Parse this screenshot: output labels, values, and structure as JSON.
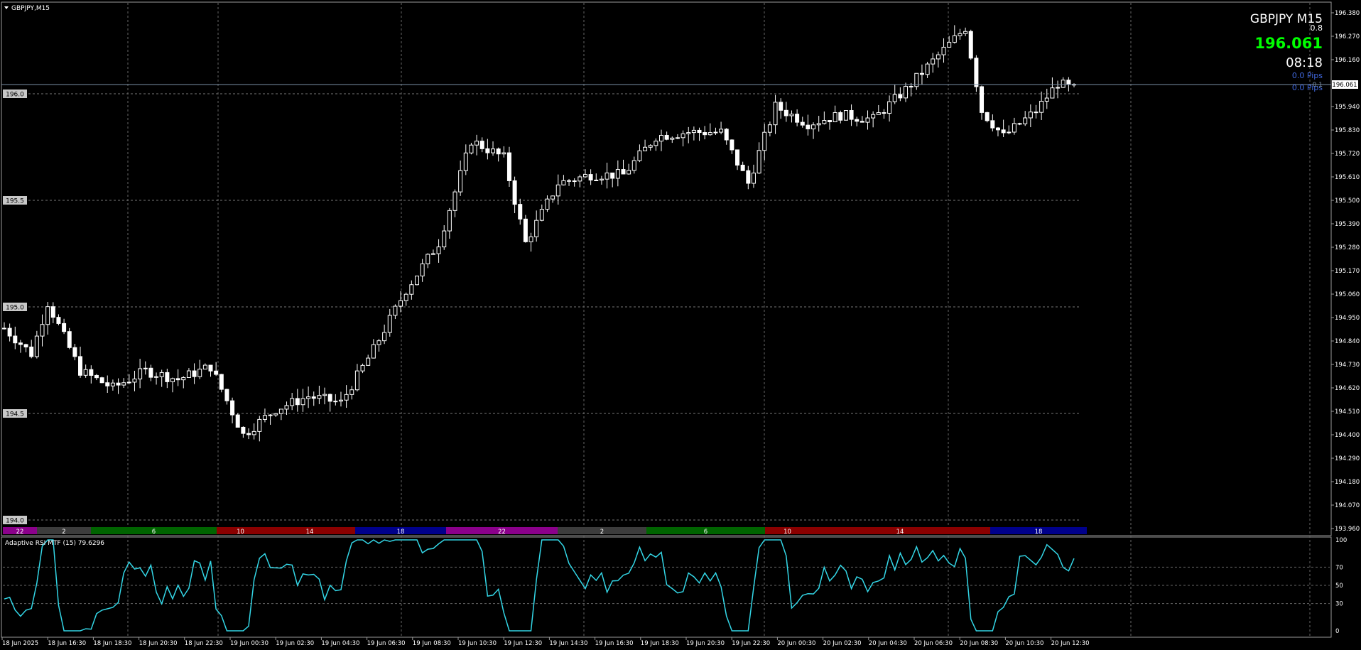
{
  "window": {
    "symbol_tab": "GBPJPY,M15",
    "menu_icon": "triangle-down-icon"
  },
  "info_panel": {
    "symbol_tf": "GBPJPY M15",
    "spread": "0.8",
    "bid": "196.061",
    "countdown": "08:18",
    "pips_1": "0.0 Pips",
    "pips_2": "0.0 Pips",
    "bid_color": "#00ff00",
    "pips_color": "#4169e1"
  },
  "price_axis": {
    "labels": [
      "196.380",
      "196.270",
      "196.160",
      "196.061",
      "195.940",
      "195.830",
      "195.720",
      "195.610",
      "195.500",
      "195.390",
      "195.280",
      "195.170",
      "195.060",
      "194.950",
      "194.840",
      "194.730",
      "194.620",
      "194.510",
      "194.400",
      "194.290",
      "194.180",
      "194.070",
      "193.960"
    ],
    "current": "196.061",
    "line_label": "0.1"
  },
  "left_levels": [
    "196.0",
    "195.5",
    "195.0",
    "194.5",
    "194.0"
  ],
  "session_bar": [
    {
      "label": "22",
      "color": "#8b008b"
    },
    {
      "label": "2",
      "color": "#3c3c3c"
    },
    {
      "label": "6",
      "color": "#006400"
    },
    {
      "label": "10",
      "color": "#8b0000"
    },
    {
      "label": "14",
      "color": "#8b0000"
    },
    {
      "label": "18",
      "color": "#00008b"
    },
    {
      "label": "22",
      "color": "#8b008b"
    },
    {
      "label": "2",
      "color": "#3c3c3c"
    },
    {
      "label": "6",
      "color": "#006400"
    },
    {
      "label": "10",
      "color": "#8b0000"
    },
    {
      "label": "14",
      "color": "#8b0000"
    },
    {
      "label": "18",
      "color": "#00008b"
    }
  ],
  "indicator": {
    "title": "Adaptive RSI MTF (15) 79.6296",
    "axis": [
      "100",
      "70",
      "50",
      "30",
      "0"
    ],
    "color": "#33d6e6"
  },
  "time_axis": [
    "18 Jun 2025",
    "18 Jun 16:30",
    "18 Jun 18:30",
    "18 Jun 20:30",
    "18 Jun 22:30",
    "19 Jun 00:30",
    "19 Jun 02:30",
    "19 Jun 04:30",
    "19 Jun 06:30",
    "19 Jun 08:30",
    "19 Jun 10:30",
    "19 Jun 12:30",
    "19 Jun 14:30",
    "19 Jun 16:30",
    "19 Jun 18:30",
    "19 Jun 20:30",
    "19 Jun 22:30",
    "20 Jun 00:30",
    "20 Jun 02:30",
    "20 Jun 04:30",
    "20 Jun 06:30",
    "20 Jun 08:30",
    "20 Jun 10:30",
    "20 Jun 12:30"
  ],
  "chart_data": {
    "type": "candlestick",
    "symbol": "GBPJPY",
    "timeframe": "M15",
    "ylim": [
      193.96,
      196.38
    ],
    "anchors": [
      [
        0,
        194.9
      ],
      [
        5,
        194.78
      ],
      [
        8,
        195.02
      ],
      [
        14,
        194.7
      ],
      [
        20,
        194.62
      ],
      [
        26,
        194.7
      ],
      [
        32,
        194.66
      ],
      [
        38,
        194.72
      ],
      [
        44,
        194.4
      ],
      [
        50,
        194.52
      ],
      [
        56,
        194.58
      ],
      [
        62,
        194.55
      ],
      [
        68,
        194.8
      ],
      [
        74,
        195.08
      ],
      [
        80,
        195.3
      ],
      [
        86,
        195.78
      ],
      [
        92,
        195.7
      ],
      [
        96,
        195.3
      ],
      [
        102,
        195.58
      ],
      [
        108,
        195.62
      ],
      [
        114,
        195.62
      ],
      [
        120,
        195.8
      ],
      [
        126,
        195.82
      ],
      [
        132,
        195.82
      ],
      [
        137,
        195.58
      ],
      [
        142,
        195.94
      ],
      [
        148,
        195.86
      ],
      [
        154,
        195.9
      ],
      [
        160,
        195.88
      ],
      [
        166,
        196.02
      ],
      [
        172,
        196.18
      ],
      [
        177,
        196.31
      ],
      [
        180,
        195.92
      ],
      [
        184,
        195.8
      ],
      [
        190,
        195.92
      ],
      [
        194,
        196.05
      ],
      [
        197,
        196.02
      ]
    ],
    "rsi_ylim": [
      0,
      100
    ],
    "rsi_levels": [
      70,
      50,
      30
    ],
    "rsi_last": 79.6296
  }
}
